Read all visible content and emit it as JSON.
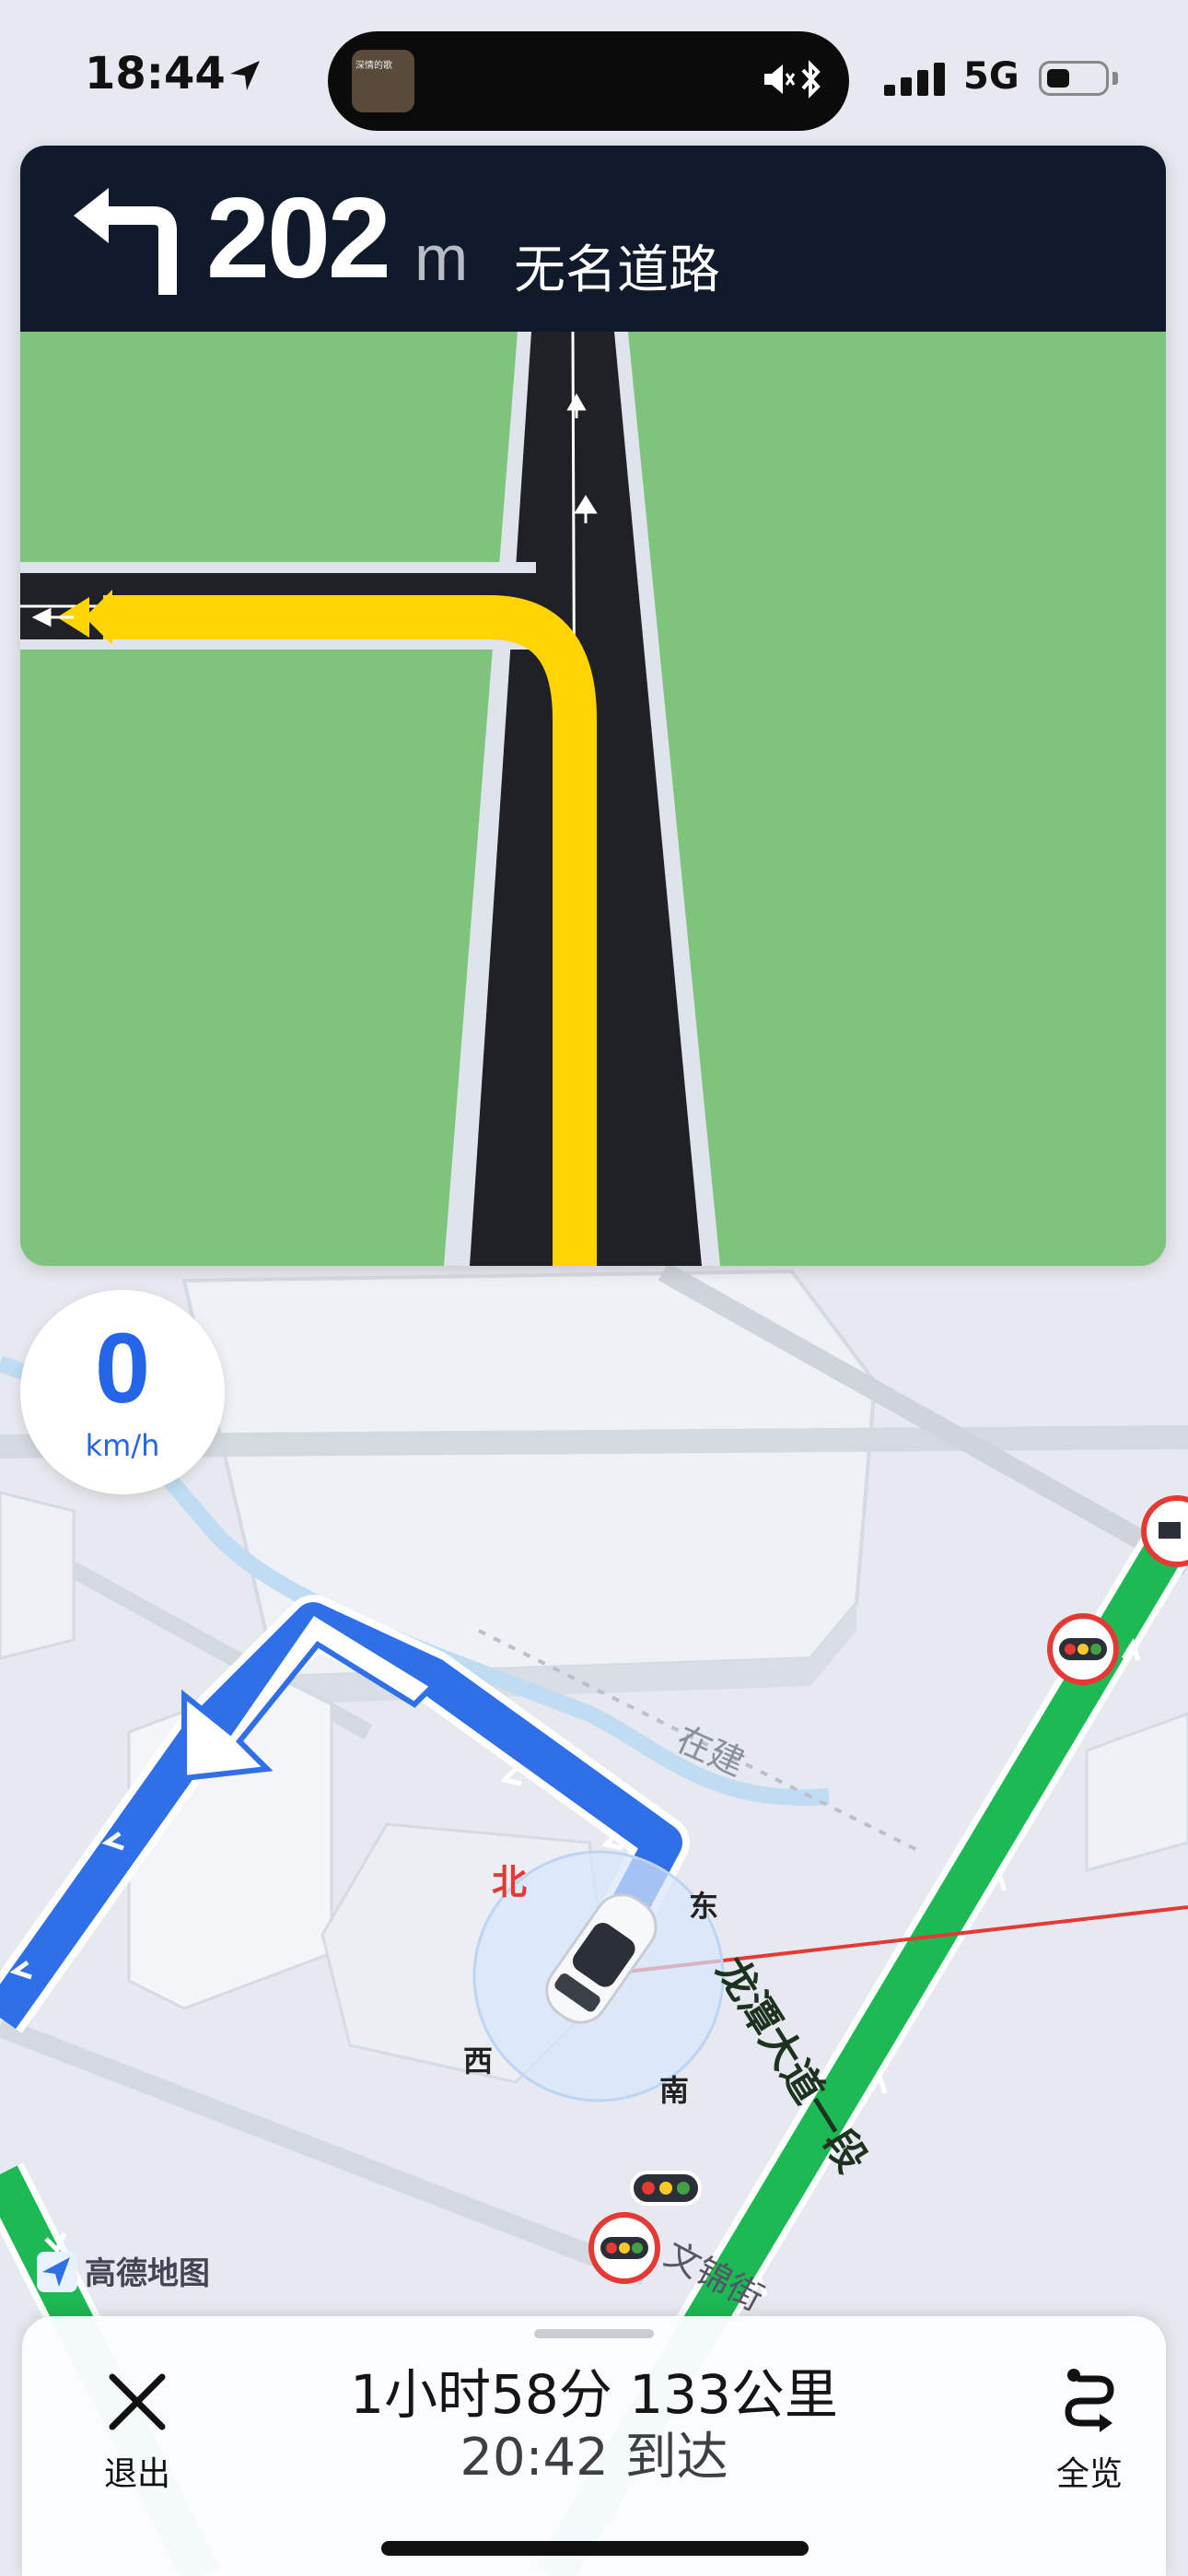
{
  "status_bar": {
    "time": "18:44",
    "island_art_text": "深情的歌",
    "network": "5G",
    "battery_percent": 30
  },
  "guidance": {
    "turn_icon": "turn-left-icon",
    "distance": "202",
    "unit": "m",
    "road_name": "无名道路"
  },
  "speed": {
    "value": "0",
    "unit": "km/h"
  },
  "map": {
    "labels": {
      "under_construction": "在建",
      "road_main": "龙潭大道一段",
      "road_wenjin": "文锦街"
    },
    "compass": {
      "north": "北",
      "east": "东",
      "west": "西",
      "south": "南"
    },
    "brand": "高德地图"
  },
  "bottom_panel": {
    "exit_label": "退出",
    "trip_summary": "1小时58分  133公里",
    "eta": "20:42 到达",
    "overview_label": "全览"
  },
  "colors": {
    "route_blue": "#2f6fe8",
    "traffic_green": "#1db954",
    "header_dark": "#111a2b",
    "junction_green": "#7ec47c",
    "guide_yellow": "#ffd400"
  }
}
